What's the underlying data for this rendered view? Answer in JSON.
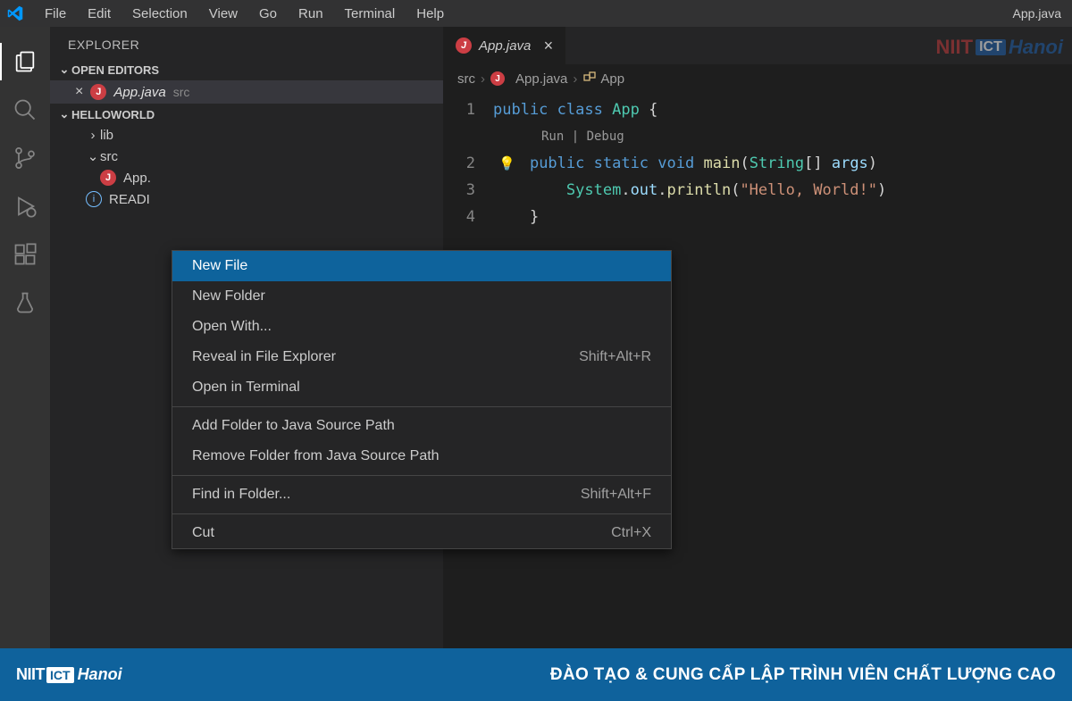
{
  "menubar": {
    "items": [
      "File",
      "Edit",
      "Selection",
      "View",
      "Go",
      "Run",
      "Terminal",
      "Help"
    ],
    "title": "App.java"
  },
  "sidebar": {
    "title": "EXPLORER",
    "openEditors": {
      "label": "OPEN EDITORS",
      "items": [
        {
          "name": "App.java",
          "location": "src"
        }
      ]
    },
    "workspace": {
      "name": "HELLOWORLD",
      "tree": {
        "lib": "lib",
        "src": "src",
        "srcFile": "App.",
        "readme": "READI"
      }
    }
  },
  "tab": {
    "name": "App.java"
  },
  "breadcrumb": {
    "part1": "src",
    "file": "App.java",
    "class": "App"
  },
  "codelens": "Run | Debug",
  "code": {
    "l1": {
      "kw1": "public",
      "kw2": "class",
      "cls": "App",
      "brace": " {"
    },
    "l2": {
      "kw1": "public",
      "kw2": "static",
      "kw3": "void",
      "fn": "main",
      "open": "(",
      "type": "String",
      "arr": "[] ",
      "arg": "args",
      "close": ")"
    },
    "l3": {
      "obj": "System",
      "dot1": ".",
      "out": "out",
      "dot2": ".",
      "fn": "println",
      "open": "(",
      "str": "\"Hello, World!\"",
      "close": ")"
    },
    "l4": "}"
  },
  "contextMenu": {
    "items": [
      {
        "label": "New File",
        "shortcut": "",
        "selected": true
      },
      {
        "label": "New Folder",
        "shortcut": ""
      },
      {
        "label": "Open With...",
        "shortcut": ""
      },
      {
        "label": "Reveal in File Explorer",
        "shortcut": "Shift+Alt+R"
      },
      {
        "label": "Open in Terminal",
        "shortcut": ""
      },
      {
        "sep": true
      },
      {
        "label": "Add Folder to Java Source Path",
        "shortcut": ""
      },
      {
        "label": "Remove Folder from Java Source Path",
        "shortcut": ""
      },
      {
        "sep": true
      },
      {
        "label": "Find in Folder...",
        "shortcut": "Shift+Alt+F"
      },
      {
        "sep": true
      },
      {
        "label": "Cut",
        "shortcut": "Ctrl+X"
      }
    ]
  },
  "watermark": {
    "niit": "NIIT",
    "ict": "ICT",
    "hanoi": "Hanoi"
  },
  "footer": {
    "logo": {
      "niit": "NIIT",
      "ict": "ICT",
      "hanoi": "Hanoi"
    },
    "text": "ĐÀO TẠO & CUNG CẤP LẬP TRÌNH VIÊN CHẤT LƯỢNG CAO"
  }
}
